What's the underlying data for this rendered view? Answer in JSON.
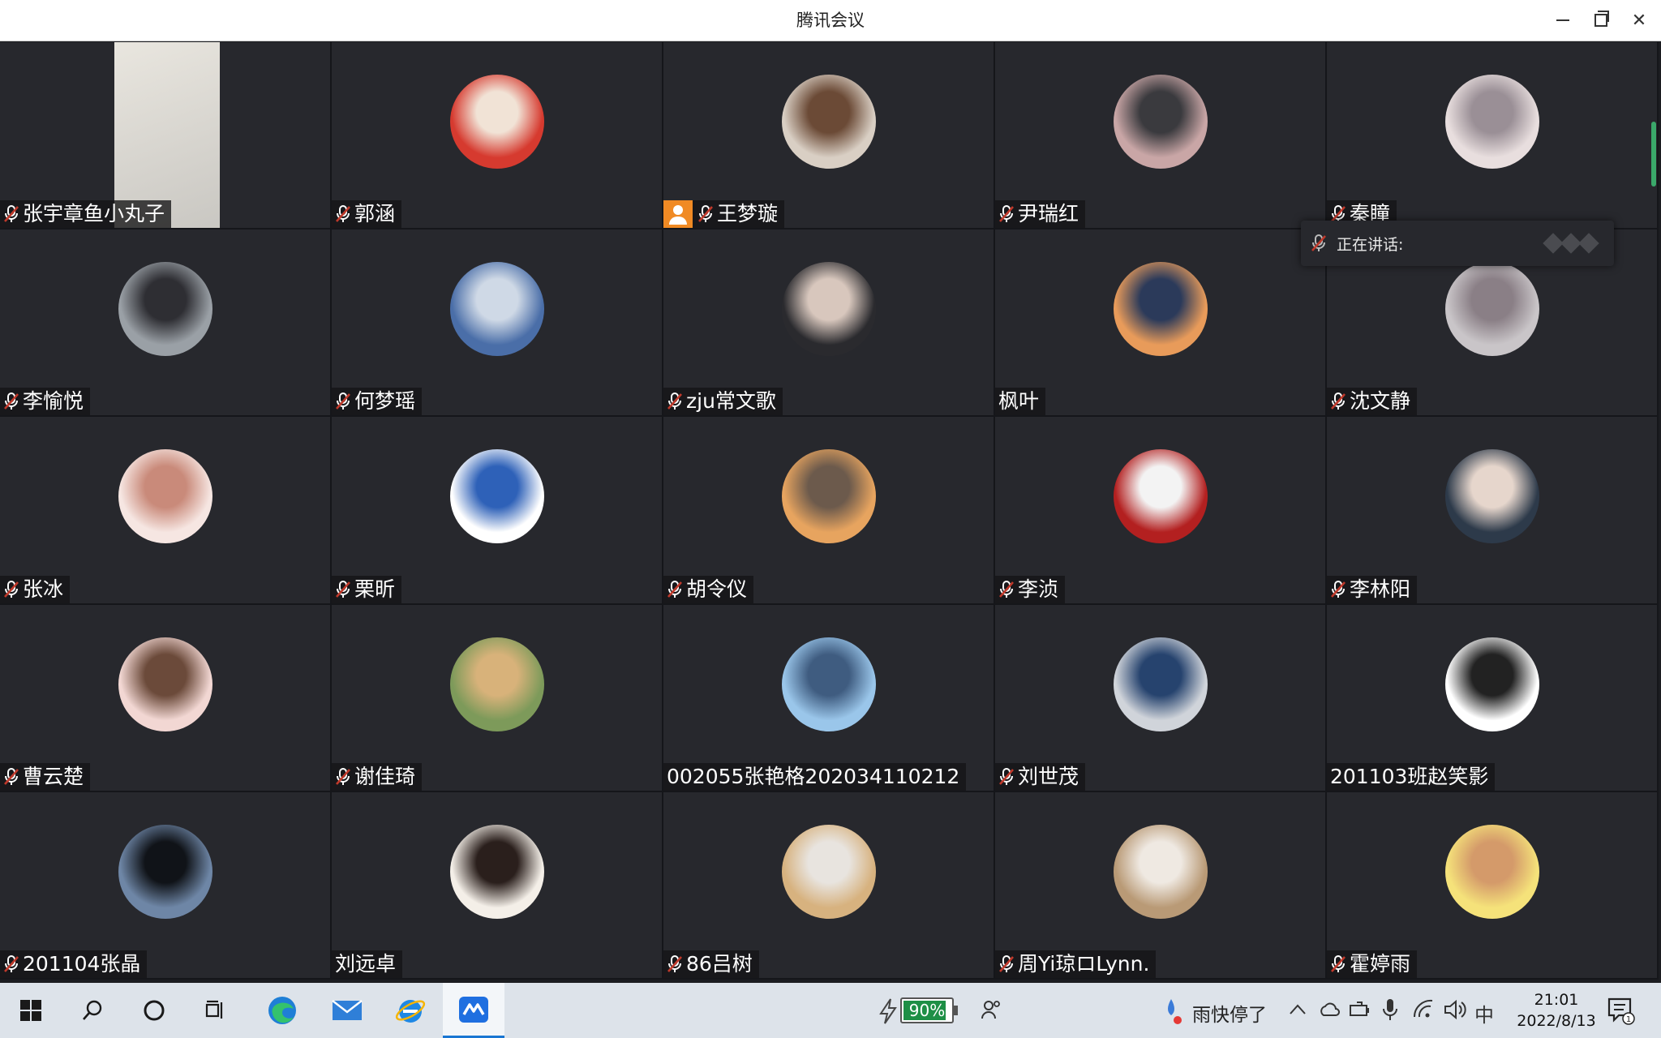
{
  "window": {
    "title": "腾讯会议"
  },
  "participants": [
    {
      "name": "张宇章鱼小丸子",
      "muted": true,
      "video": true,
      "colors": [
        "#e9e6df",
        "#c9c7c2"
      ]
    },
    {
      "name": "郭涵",
      "muted": true,
      "colors": [
        "#d63a2f",
        "#f1e3d6"
      ]
    },
    {
      "name": "王梦璇",
      "muted": true,
      "host": true,
      "colors": [
        "#d9cfc4",
        "#6b4a36"
      ]
    },
    {
      "name": "尹瑞红",
      "muted": true,
      "colors": [
        "#c9a6a6",
        "#3a3a3e"
      ]
    },
    {
      "name": "秦瞳",
      "muted": true,
      "colors": [
        "#e8dede",
        "#9a8f96"
      ]
    },
    {
      "name": "李愉悦",
      "muted": true,
      "colors": [
        "#9aa0a6",
        "#2e2e33"
      ]
    },
    {
      "name": "何梦瑶",
      "muted": true,
      "colors": [
        "#4a6ea8",
        "#cfd9e6"
      ]
    },
    {
      "name": "zju常文歌",
      "muted": true,
      "colors": [
        "#2a2a2e",
        "#d8c7bd"
      ]
    },
    {
      "name": "枫叶",
      "muted": false,
      "colors": [
        "#e89b5a",
        "#2b3a5a"
      ]
    },
    {
      "name": "沈文静",
      "muted": true,
      "colors": [
        "#c9c5c8",
        "#8a7f86"
      ]
    },
    {
      "name": "张冰",
      "muted": true,
      "colors": [
        "#f6e6e2",
        "#c98a7a"
      ]
    },
    {
      "name": "栗昕",
      "muted": true,
      "colors": [
        "#ffffff",
        "#2e61b8"
      ]
    },
    {
      "name": "胡令仪",
      "muted": true,
      "colors": [
        "#e7a45f",
        "#6c5a4c"
      ]
    },
    {
      "name": "李浈",
      "muted": true,
      "colors": [
        "#b32020",
        "#f3f3f3"
      ]
    },
    {
      "name": "李林阳",
      "muted": true,
      "colors": [
        "#2d3a4a",
        "#e6d6cc"
      ]
    },
    {
      "name": "曹云楚",
      "muted": true,
      "colors": [
        "#f2d7d3",
        "#6b4a3a"
      ]
    },
    {
      "name": "谢佳琦",
      "muted": true,
      "colors": [
        "#7d9a5a",
        "#d8b27a"
      ]
    },
    {
      "name": "002055张艳格202034110212",
      "muted": false,
      "colors": [
        "#9ac6ea",
        "#3f5c80"
      ]
    },
    {
      "name": "刘世茂",
      "muted": true,
      "colors": [
        "#d0d4da",
        "#26436e"
      ]
    },
    {
      "name": "201103班赵笑影",
      "muted": false,
      "colors": [
        "#ffffff",
        "#222222"
      ]
    },
    {
      "name": "201104张晶",
      "muted": true,
      "colors": [
        "#6e86a6",
        "#101318"
      ]
    },
    {
      "name": "刘远卓",
      "muted": false,
      "colors": [
        "#f4efe8",
        "#2a1f1c"
      ]
    },
    {
      "name": "86吕树",
      "muted": true,
      "colors": [
        "#d7b27f",
        "#e8e4df"
      ]
    },
    {
      "name": "周Yi琼ロLynn.",
      "muted": true,
      "colors": [
        "#b99a76",
        "#efe9e2"
      ]
    },
    {
      "name": "霍婷雨",
      "muted": true,
      "colors": [
        "#f5e27a",
        "#d49a6a"
      ]
    }
  ],
  "speaking_popup": {
    "label": "正在讲话:"
  },
  "taskbar": {
    "battery": {
      "percent_label": "90%",
      "level": 0.9
    },
    "weather": "雨快停了",
    "ime": "中",
    "time": "21:01",
    "date": "2022/8/13",
    "notifications": "1"
  },
  "accent_colors": {
    "mute": "#c0392b",
    "host": "#f08a24",
    "battery": "#1e8f46"
  }
}
